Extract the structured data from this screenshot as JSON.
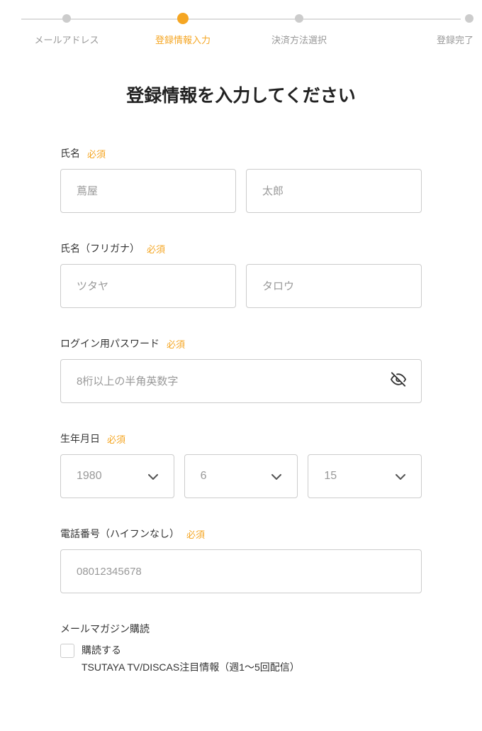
{
  "stepper": {
    "steps": [
      {
        "label": "メールアドレス"
      },
      {
        "label": "登録情報入力"
      },
      {
        "label": "決済方法選択"
      },
      {
        "label": "登録完了"
      }
    ]
  },
  "title": "登録情報を入力してください",
  "required_label": "必須",
  "fields": {
    "name": {
      "label": "氏名",
      "last_placeholder": "蔦屋",
      "first_placeholder": "太郎"
    },
    "furigana": {
      "label": "氏名（フリガナ）",
      "last_placeholder": "ツタヤ",
      "first_placeholder": "タロウ"
    },
    "password": {
      "label": "ログイン用パスワード",
      "placeholder": "8桁以上の半角英数字"
    },
    "birthday": {
      "label": "生年月日",
      "year": "1980",
      "month": "6",
      "day": "15"
    },
    "phone": {
      "label": "電話番号（ハイフンなし）",
      "placeholder": "08012345678"
    },
    "magazine": {
      "label": "メールマガジン購読",
      "checkbox_label": "購読する",
      "description": "TSUTAYA TV/DISCAS注目情報（週1～5回配信）"
    }
  }
}
